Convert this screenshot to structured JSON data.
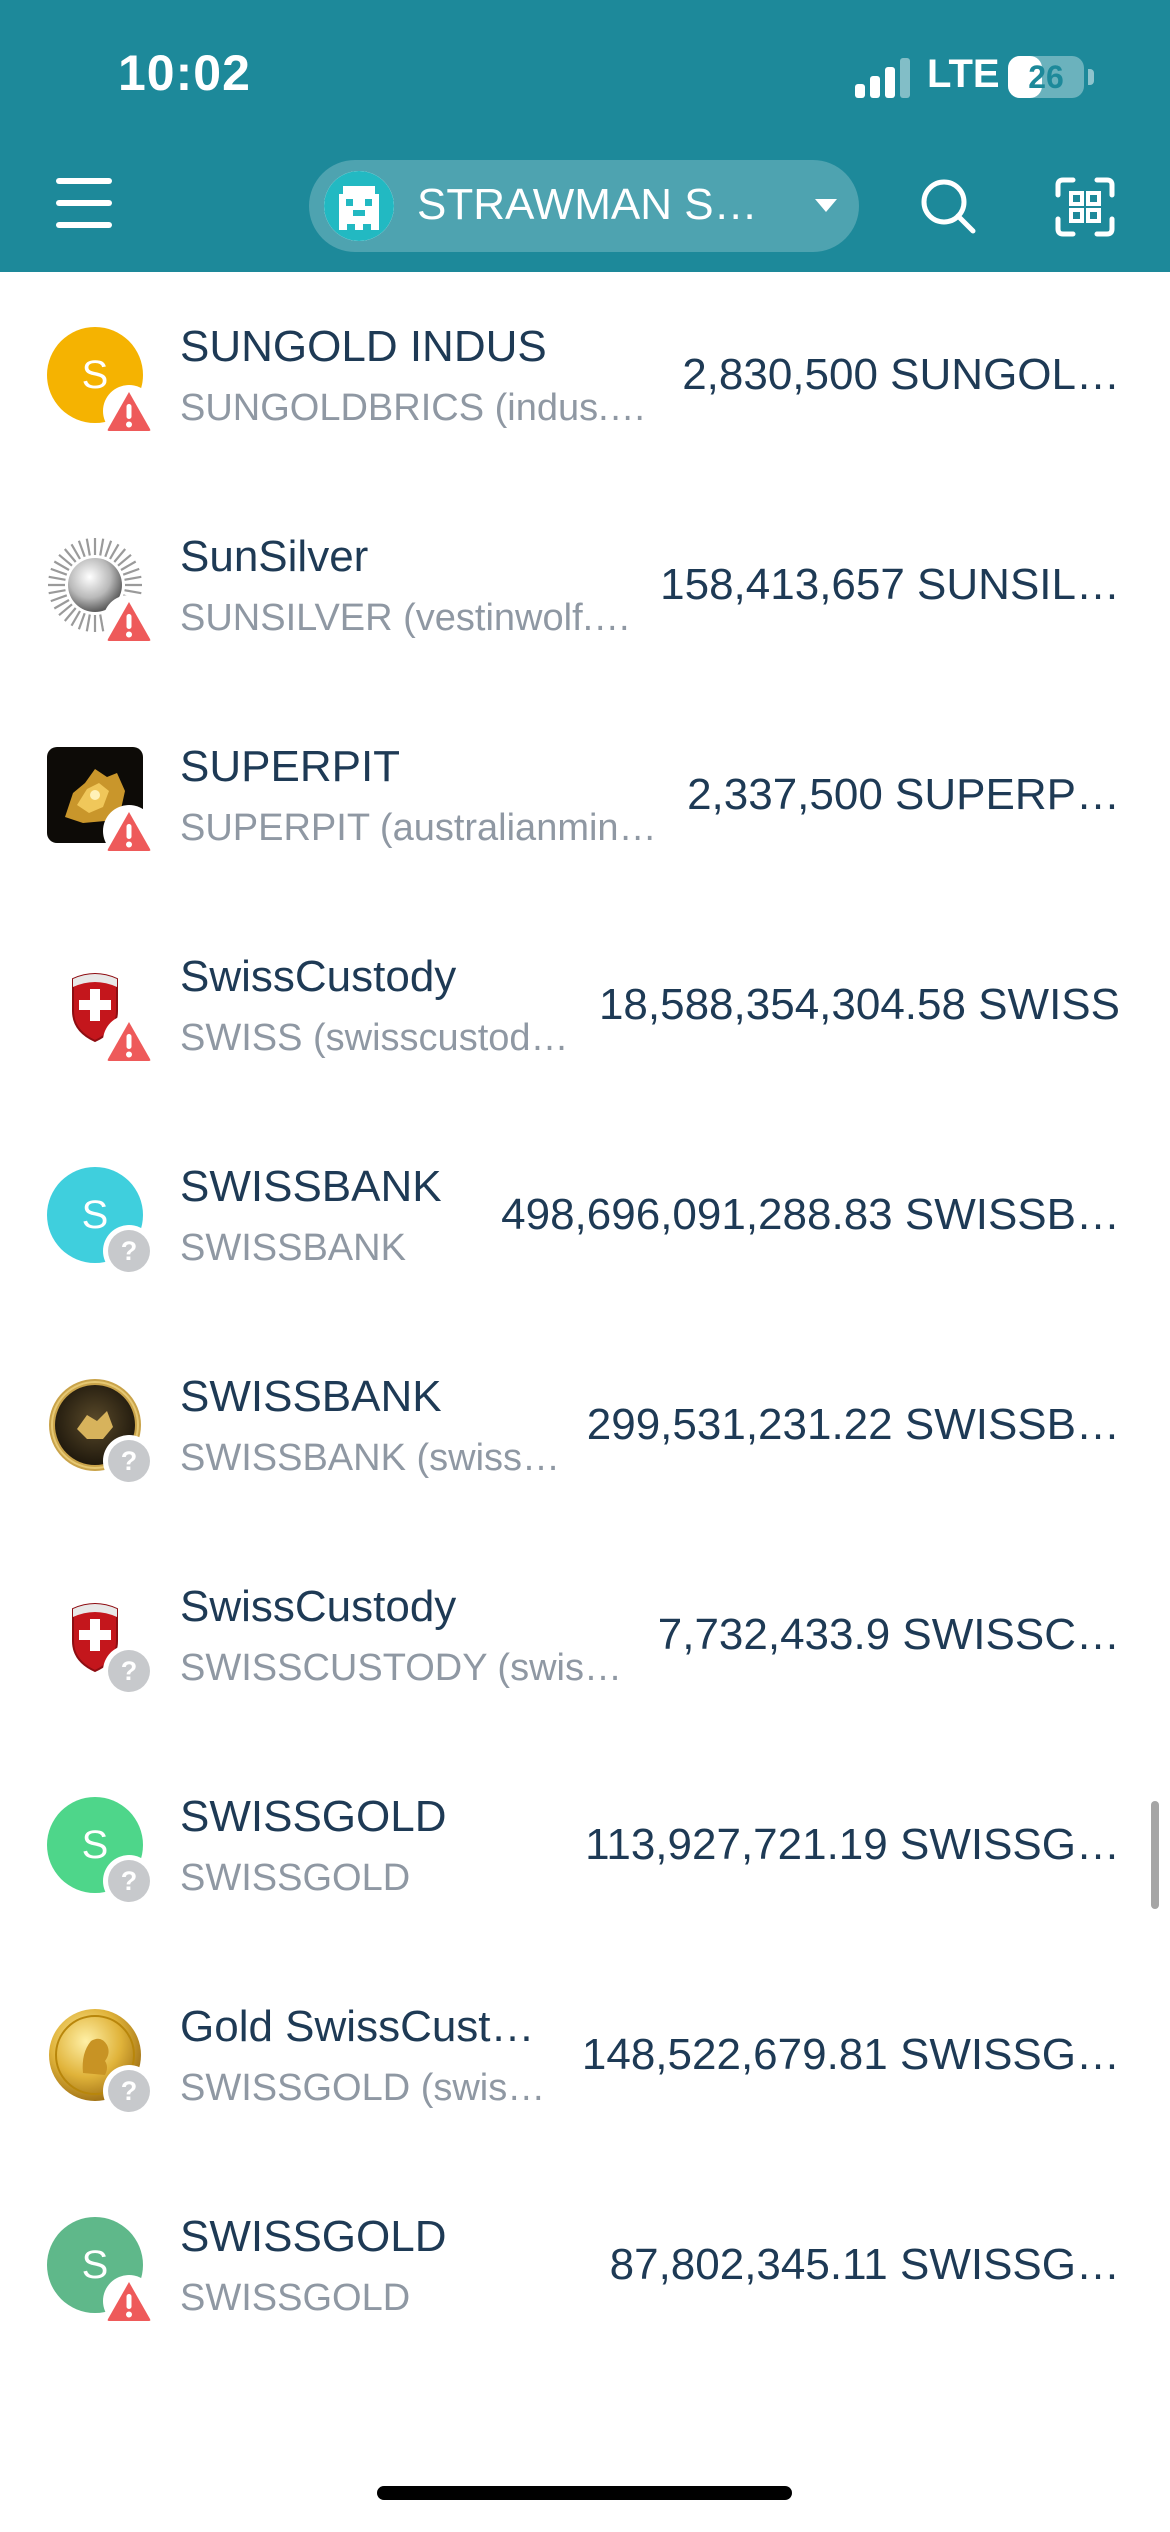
{
  "status_bar": {
    "time": "10:02",
    "network": "LTE",
    "battery": "26",
    "battery_level_percent": 26
  },
  "header": {
    "account_name": "STRAWMAN ST…",
    "menu_icon": "menu-icon",
    "search_icon": "search-icon",
    "scan_icon": "qr-scan-icon",
    "background_color": "#1d899a"
  },
  "tokens": [
    {
      "name": "SUNGOLD INDUS",
      "subtitle": "SUNGOLDBRICS (indus.…",
      "balance": "2,830,500 SUNGOL…",
      "logo": "letter",
      "logo_letter": "S",
      "logo_color": "#f5b301",
      "status": "warning"
    },
    {
      "name": "SunSilver",
      "subtitle": "SUNSILVER (vestinwolf.…",
      "balance": "158,413,657 SUNSIL…",
      "logo": "sun",
      "status": "warning"
    },
    {
      "name": "SUPERPIT",
      "subtitle": "SUPERPIT (australianmines…",
      "balance": "2,337,500 SUPERP…",
      "logo": "gold-nugget",
      "status": "warning"
    },
    {
      "name": "SwissCustody",
      "subtitle": "SWISS (swisscustod…",
      "balance": "18,588,354,304.58 SWISS",
      "logo": "swiss-shield",
      "status": "warning"
    },
    {
      "name": "SWISSBANK",
      "subtitle": "SWISSBANK",
      "balance": "498,696,091,288.83 SWISSB…",
      "logo": "letter",
      "logo_letter": "S",
      "logo_color": "#3fcfdd",
      "status": "unknown"
    },
    {
      "name": "SWISSBANK",
      "subtitle": "SWISSBANK (swissc…",
      "balance": "299,531,231.22 SWISSB…",
      "logo": "swissbank-coin",
      "status": "unknown"
    },
    {
      "name": "SwissCustody",
      "subtitle": "SWISSCUSTODY (swiss…",
      "balance": "7,732,433.9 SWISSC…",
      "logo": "swiss-shield",
      "status": "unknown"
    },
    {
      "name": "SWISSGOLD",
      "subtitle": "SWISSGOLD",
      "balance": "113,927,721.19 SWISSG…",
      "logo": "letter",
      "logo_letter": "S",
      "logo_color": "#4ed68a",
      "status": "unknown"
    },
    {
      "name": "Gold SwissCusto…",
      "subtitle": "SWISSGOLD (swiss…",
      "balance": "148,522,679.81 SWISSG…",
      "logo": "gold-coin",
      "status": "unknown"
    },
    {
      "name": "SWISSGOLD",
      "subtitle": "SWISSGOLD",
      "balance": "87,802,345.11 SWISSG…",
      "logo": "letter",
      "logo_letter": "S",
      "logo_color": "#5fb88a",
      "status": "warning"
    }
  ],
  "colors": {
    "warning": "#ee5a5a",
    "unknown": "#c7c9cc",
    "text_primary": "#1e3a55",
    "text_secondary": "#8f98a3"
  }
}
